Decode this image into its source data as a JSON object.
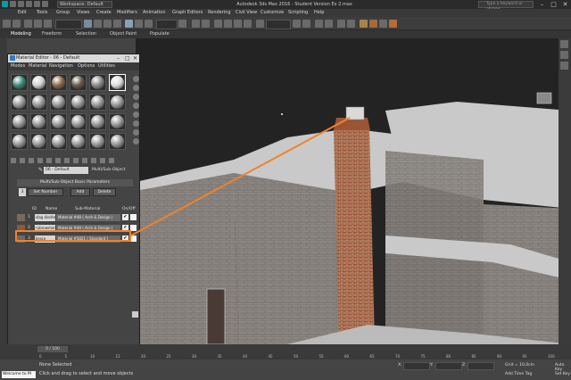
{
  "window": {
    "workspace": "Workspace: Default",
    "title": "Autodesk 3ds Max 2016 - Student Version   Ex 2.max",
    "search_placeholder": "Type a keyword or phrase"
  },
  "menu": [
    "Edit",
    "Tools",
    "Group",
    "Views",
    "Create",
    "Modifiers",
    "Animation",
    "Graph Editors",
    "Rendering",
    "Civil View",
    "Customize",
    "Scripting",
    "Help"
  ],
  "ribbon": [
    "Modeling",
    "Freeform",
    "Selection",
    "Object Paint",
    "Populate"
  ],
  "material_editor": {
    "title": "Material Editor - 06 - Default",
    "menu": [
      "Modes",
      "Material",
      "Navigation",
      "Options",
      "Utilities"
    ],
    "material_name": "06 - Default",
    "material_type": "Multi/Sub-Object",
    "rollout_title": "Multi/Sub-Object Basic Parameters",
    "set_number_label": "Set Number",
    "count": "3",
    "add_label": "Add",
    "delete_label": "Delete",
    "headers": {
      "id": "ID",
      "name": "Name",
      "sub": "Sub-Material",
      "onoff": "On/Off"
    },
    "rows": [
      {
        "id": "1",
        "name": "slag diorite",
        "sub": "Material #48 ( Arch & Design )",
        "color": "#7a6a5a"
      },
      {
        "id": "2",
        "name": "rubrowmen",
        "sub": "Material #49 ( Arch & Design )",
        "color": "#8a5a3a"
      },
      {
        "id": "3",
        "name": "brace",
        "sub": "Material #5821 ( Standard )",
        "color": "#6a6a6a"
      }
    ]
  },
  "status": {
    "welcome": "Welcome to M",
    "selection": "None Selected",
    "hint": "Click and drag to select and move objects",
    "x_label": "X:",
    "y_label": "Y:",
    "z_label": "Z:",
    "grid": "Grid = 10,0cm",
    "add_time_tag": "Add Time Tag",
    "auto_key": "Auto Key",
    "set_key": "Set Key"
  },
  "timeline": {
    "slider": "0 / 100",
    "ticks": [
      "0",
      "5",
      "10",
      "15",
      "20",
      "25",
      "30",
      "35",
      "40",
      "45",
      "50",
      "55",
      "60",
      "65",
      "70",
      "75",
      "80",
      "85",
      "90",
      "95",
      "100"
    ]
  },
  "colors": {
    "accent": "#f0822a",
    "viewport_bg": "#232323",
    "brick": "#9a5535",
    "wall": "#8a8580",
    "roof": "#c9c9c9"
  }
}
